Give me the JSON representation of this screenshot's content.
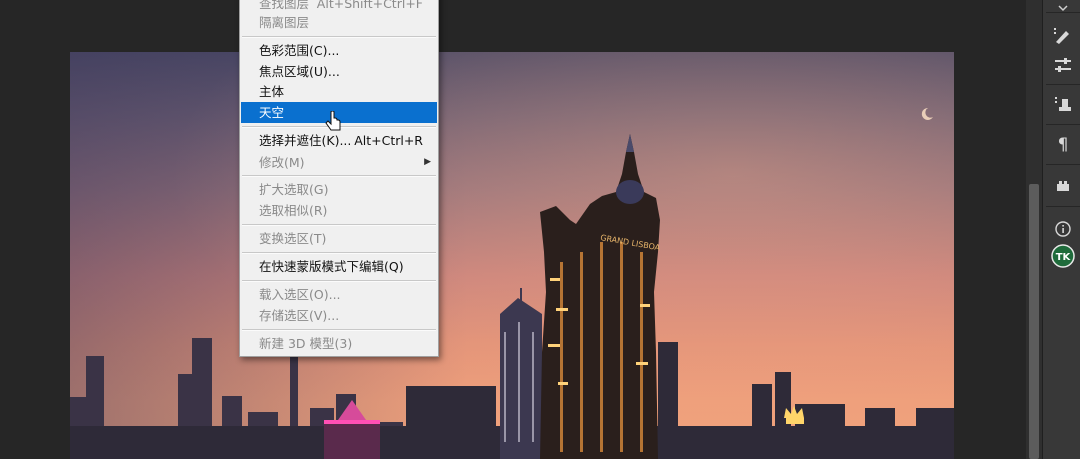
{
  "menu": {
    "items": [
      {
        "label": "查找图层",
        "shortcut": "Alt+Shift+Ctrl+F",
        "disabled": true
      },
      {
        "label": "隔离图层",
        "shortcut": "",
        "disabled": true
      },
      {
        "label": "色彩范围(C)...",
        "shortcut": "",
        "disabled": false
      },
      {
        "label": "焦点区域(U)...",
        "shortcut": "",
        "disabled": false
      },
      {
        "label": "主体",
        "shortcut": "",
        "disabled": false
      },
      {
        "label": "天空",
        "shortcut": "",
        "disabled": false,
        "highlighted": true
      },
      {
        "label": "选择并遮住(K)...",
        "shortcut": "Alt+Ctrl+R",
        "disabled": false
      },
      {
        "label": "修改(M)",
        "shortcut": "",
        "disabled": true,
        "submenu": true
      },
      {
        "label": "扩大选取(G)",
        "shortcut": "",
        "disabled": true
      },
      {
        "label": "选取相似(R)",
        "shortcut": "",
        "disabled": true
      },
      {
        "label": "变换选区(T)",
        "shortcut": "",
        "disabled": true
      },
      {
        "label": "在快速蒙版模式下编辑(Q)",
        "shortcut": "",
        "disabled": false
      },
      {
        "label": "载入选区(O)...",
        "shortcut": "",
        "disabled": true
      },
      {
        "label": "存储选区(V)...",
        "shortcut": "",
        "disabled": true
      },
      {
        "label": "新建 3D 模型(3)",
        "shortcut": "",
        "disabled": true
      }
    ]
  },
  "canvas": {
    "sign_text": "GRAND LISBOA"
  },
  "panel": {
    "tools": [
      {
        "icon": "brush-settings-icon"
      },
      {
        "icon": "adjustments-icon"
      },
      {
        "icon": "clone-source-icon"
      },
      {
        "icon": "paragraph-icon"
      },
      {
        "icon": "glyphs-icon"
      },
      {
        "icon": "info-icon"
      },
      {
        "icon": "tk-plugin-icon"
      }
    ]
  },
  "colors": {
    "menu_highlight": "#0a70cf",
    "menu_bg": "#f0f0f0",
    "workspace_bg": "#262626",
    "panel_bg": "#383838"
  }
}
